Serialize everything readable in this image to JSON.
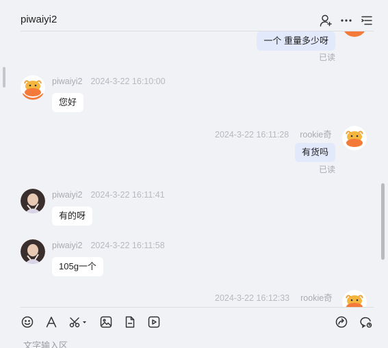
{
  "header": {
    "title": "piwaiyi2",
    "icons": [
      "add-user-icon",
      "more-icon",
      "menu-list-icon"
    ]
  },
  "messages": [
    {
      "id": "m0",
      "direction": "out",
      "text": "一个  重量多少呀",
      "read": "已读",
      "partial": true
    },
    {
      "id": "m1",
      "direction": "in",
      "sender": "piwaiyi2",
      "time": "2024-3-22 16:10:00",
      "text": "您好",
      "avatar": "cow-avatar"
    },
    {
      "id": "m2",
      "direction": "out",
      "sender": "rookie奇",
      "time": "2024-3-22 16:11:28",
      "text": "有货吗",
      "read": "已读",
      "avatar": "cow-avatar"
    },
    {
      "id": "m3",
      "direction": "in",
      "sender": "piwaiyi2",
      "time": "2024-3-22 16:11:41",
      "text": "有的呀",
      "avatar": "photo-avatar"
    },
    {
      "id": "m4",
      "direction": "in",
      "sender": "piwaiyi2",
      "time": "2024-3-22 16:11:58",
      "text": "105g一个",
      "avatar": "photo-avatar"
    },
    {
      "id": "m5",
      "direction": "out",
      "sender": "rookie奇",
      "time": "2024-3-22 16:12:33",
      "partial": true,
      "avatar": "cow-avatar"
    }
  ],
  "toolbar": {
    "left_icons": [
      "emoji-icon",
      "font-icon",
      "scissors-icon",
      "image-icon",
      "file-icon",
      "video-icon"
    ],
    "right_icons": [
      "share-icon",
      "chat-history-icon"
    ]
  },
  "input": {
    "placeholder": "文字输入区"
  },
  "colors": {
    "background": "#f1f2f5",
    "incoming_bubble": "#ffffff",
    "outgoing_bubble": "#e2e9fb",
    "avatar_orange": "#f47a3a"
  }
}
